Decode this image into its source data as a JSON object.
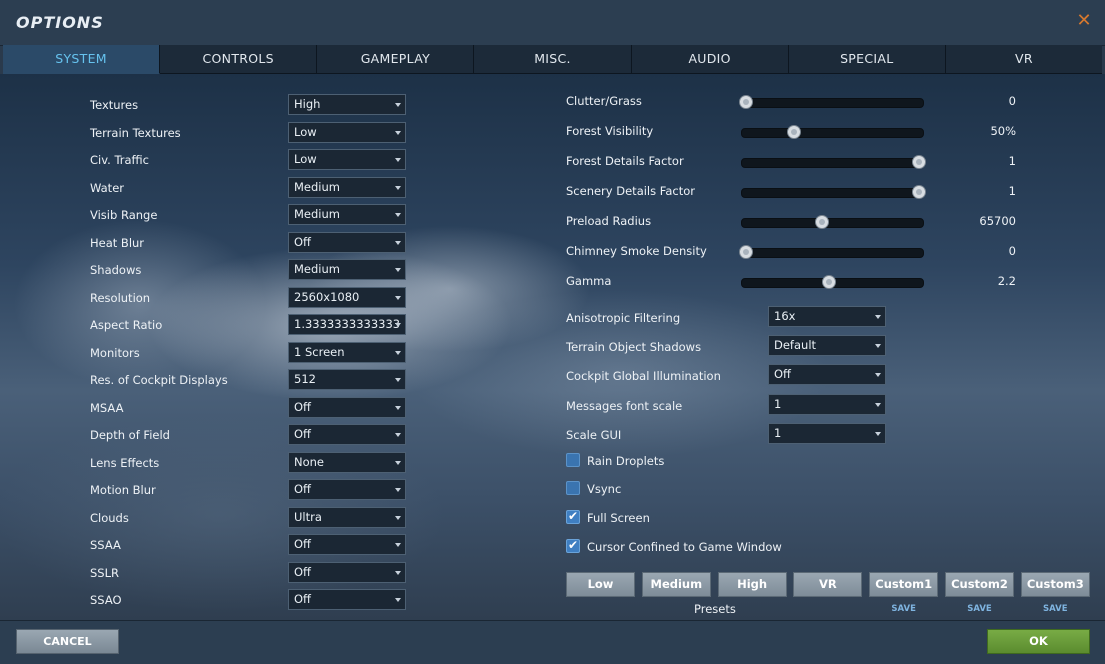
{
  "title": "OPTIONS",
  "tabs": [
    "SYSTEM",
    "CONTROLS",
    "GAMEPLAY",
    "MISC.",
    "AUDIO",
    "SPECIAL",
    "VR"
  ],
  "active_tab": "SYSTEM",
  "left_settings": [
    {
      "label": "Textures",
      "value": "High"
    },
    {
      "label": "Terrain Textures",
      "value": "Low"
    },
    {
      "label": "Civ. Traffic",
      "value": "Low"
    },
    {
      "label": "Water",
      "value": "Medium"
    },
    {
      "label": "Visib Range",
      "value": "Medium"
    },
    {
      "label": "Heat Blur",
      "value": "Off"
    },
    {
      "label": "Shadows",
      "value": "Medium"
    },
    {
      "label": "Resolution",
      "value": "2560x1080"
    },
    {
      "label": "Aspect Ratio",
      "value": "1.3333333333333"
    },
    {
      "label": "Monitors",
      "value": "1 Screen"
    },
    {
      "label": "Res. of Cockpit Displays",
      "value": "512"
    },
    {
      "label": "MSAA",
      "value": "Off"
    },
    {
      "label": "Depth of Field",
      "value": "Off"
    },
    {
      "label": "Lens Effects",
      "value": "None"
    },
    {
      "label": "Motion Blur",
      "value": "Off"
    },
    {
      "label": "Clouds",
      "value": "Ultra"
    },
    {
      "label": "SSAA",
      "value": "Off"
    },
    {
      "label": "SSLR",
      "value": "Off"
    },
    {
      "label": "SSAO",
      "value": "Off"
    }
  ],
  "sliders": [
    {
      "label": "Clutter/Grass",
      "value": "0",
      "level": 0.02
    },
    {
      "label": "Forest Visibility",
      "value": "50%",
      "level": 0.29
    },
    {
      "label": "Forest Details Factor",
      "value": "1",
      "level": 0.98
    },
    {
      "label": "Scenery Details Factor",
      "value": "1",
      "level": 0.98
    },
    {
      "label": "Preload Radius",
      "value": "65700",
      "level": 0.44
    },
    {
      "label": "Chimney Smoke Density",
      "value": "0",
      "level": 0.02
    },
    {
      "label": "Gamma",
      "value": "2.2",
      "level": 0.48
    }
  ],
  "right_dropdowns": [
    {
      "label": "Anisotropic Filtering",
      "value": "16x"
    },
    {
      "label": "Terrain Object Shadows",
      "value": "Default"
    },
    {
      "label": "Cockpit Global Illumination",
      "value": "Off"
    },
    {
      "label": "Messages font scale",
      "value": "1"
    },
    {
      "label": "Scale GUI",
      "value": "1"
    }
  ],
  "checkboxes": [
    {
      "label": "Rain Droplets",
      "checked": false
    },
    {
      "label": "Vsync",
      "checked": false
    },
    {
      "label": "Full Screen",
      "checked": true
    },
    {
      "label": "Cursor Confined to Game Window",
      "checked": true
    }
  ],
  "presets": {
    "label": "Presets",
    "buttons": [
      "Low",
      "Medium",
      "High",
      "VR",
      "Custom1",
      "Custom2",
      "Custom3"
    ],
    "save_label": "SAVE"
  },
  "footer": {
    "cancel_label": "CANCEL",
    "ok_label": "OK"
  }
}
